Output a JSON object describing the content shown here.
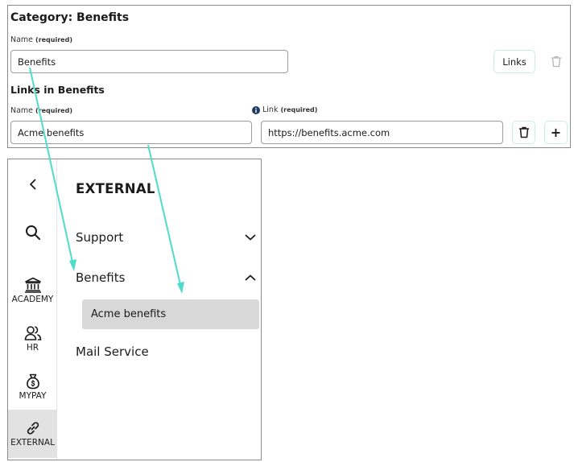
{
  "editor": {
    "category_title": "Category: Benefits",
    "name_label": "Name",
    "required_tag": "(required)",
    "name_value": "Benefits",
    "links_button": "Links",
    "links_heading": "Links in Benefits",
    "link_name_label": "Name",
    "link_url_label": "Link",
    "link_name_value": "Acme benefits",
    "link_url_value": "https://benefits.acme.com",
    "info_icon": "info-icon",
    "delete_icon": "trash-icon",
    "add_icon": "plus-icon"
  },
  "sidebar": {
    "back_icon": "chevron-left-icon",
    "search_icon": "search-icon",
    "rail_items": [
      {
        "label": "ACADEMY",
        "icon": "bank-icon"
      },
      {
        "label": "HR",
        "icon": "people-icon"
      },
      {
        "label": "MYPAY",
        "icon": "money-bag-icon"
      },
      {
        "label": "EXTERNAL",
        "icon": "link-icon"
      }
    ],
    "active_rail_item": "EXTERNAL",
    "menu_title": "EXTERNAL",
    "menu_items": [
      {
        "label": "Support",
        "state": "collapsed"
      },
      {
        "label": "Benefits",
        "state": "expanded"
      },
      {
        "label": "Mail Service",
        "state": "none"
      }
    ],
    "submenu_items": [
      "Acme benefits"
    ]
  },
  "colors": {
    "arrow": "#4fdccb",
    "active_rail_bg": "#e2e2e2",
    "submenu_bg": "#d8d8d8",
    "button_border": "#c9ecea",
    "text": "#1b1b1b"
  }
}
